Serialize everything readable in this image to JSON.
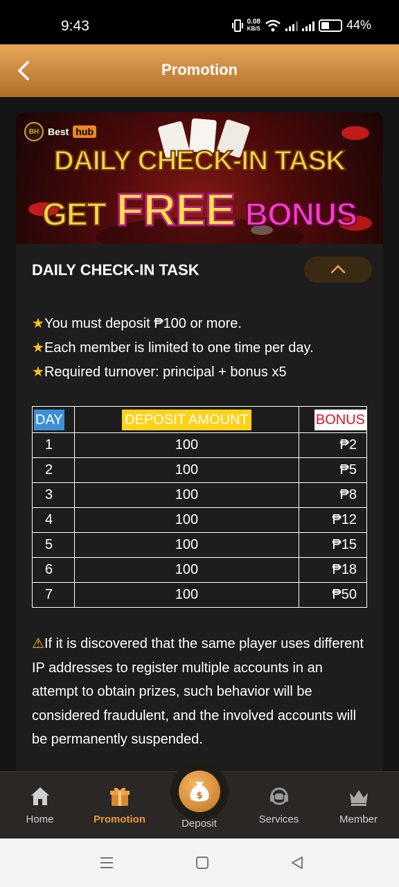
{
  "status_bar": {
    "time": "9:43",
    "net_speed_value": "0.08",
    "net_speed_unit": "KB/S",
    "battery": "44%",
    "battery_level": 0.44
  },
  "header": {
    "title": "Promotion",
    "back_icon": "chevron-left-icon"
  },
  "banner": {
    "brand_name": "Best",
    "brand_tag": "hub",
    "brand_seal": "BH",
    "headline": "DAILY CHECK-IN TASK",
    "tagline_get": "GET",
    "tagline_free": "FREE",
    "tagline_bonus": "BONUS"
  },
  "section": {
    "title": "DAILY CHECK-IN TASK",
    "toggle_icon": "chevron-up-icon"
  },
  "rules": [
    "You must deposit ₱100 or more.",
    "Each member is limited to one time per day.",
    "Required turnover: principal + bonus x5"
  ],
  "rule_icon": "star-icon",
  "table": {
    "headers": [
      "DAY",
      "DEPOSIT AMOUNT",
      "BONUS"
    ],
    "rows": [
      [
        "1",
        "100",
        "₱2"
      ],
      [
        "2",
        "100",
        "₱5"
      ],
      [
        "3",
        "100",
        "₱8"
      ],
      [
        "4",
        "100",
        "₱12"
      ],
      [
        "5",
        "100",
        "₱15"
      ],
      [
        "6",
        "100",
        "₱18"
      ],
      [
        "7",
        "100",
        "₱50"
      ]
    ]
  },
  "warning": {
    "icon": "warning-icon",
    "text": "If it is discovered that the same player uses different IP addresses to register multiple accounts in an attempt to obtain prizes, such behavior will be considered fraudulent, and the involved accounts will be permanently suspended."
  },
  "bottom_nav": {
    "items": [
      {
        "label": "Home",
        "icon": "home-icon"
      },
      {
        "label": "Promotion",
        "icon": "gift-icon",
        "active": true
      },
      {
        "label": "Deposit",
        "icon": "money-bag-icon"
      },
      {
        "label": "Services",
        "icon": "headset-icon"
      },
      {
        "label": "Member",
        "icon": "crown-icon"
      }
    ]
  },
  "colors": {
    "header_gradient_top": "#e8a657",
    "header_gradient_bottom": "#b06e2a",
    "active_nav": "#e89a3a",
    "star": "#ffc21a",
    "day_highlight": "#3f8fd8",
    "deposit_highlight": "#ffd21a",
    "bonus_highlight": "#e0102a"
  }
}
